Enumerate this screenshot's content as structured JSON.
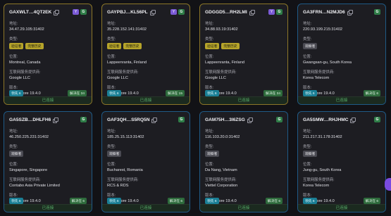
{
  "labels": {
    "address": "地址:",
    "type": "类型:",
    "location": "位置:",
    "isp": "互联网服务提供商:",
    "version": "版本:",
    "status": "已连接"
  },
  "cards": [
    {
      "name": "GAXWLT…4QT2EK",
      "badge1": "Y",
      "badge2": "G",
      "addr": "34.47.29.105:31402",
      "types": [
        "验证者",
        "完整历史"
      ],
      "loc": "Montreal, Canada",
      "isp": "Google LLC",
      "ver": "stellar-core 19.4.0",
      "pill1": "领先 6",
      "pill2": "解决在 34",
      "border": "gold"
    },
    {
      "name": "GAYPBJ…KL56PL",
      "badge1": "Y",
      "badge2": "G",
      "addr": "35.228.152.141:31402",
      "types": [
        "验证者",
        "完整历史"
      ],
      "loc": "Lappeenranta, Finland",
      "isp": "Google LLC",
      "ver": "stellar-core 19.4.0",
      "pill1": "领先 6",
      "pill2": "解决在 15",
      "border": "gold"
    },
    {
      "name": "GDGGD5…RH2LMI",
      "badge1": "Y",
      "badge2": "G",
      "addr": "34.88.93.19:31402",
      "types": [
        "验证者",
        "完整历史"
      ],
      "loc": "Lappeenranta, Finland",
      "isp": "Google LLC",
      "ver": "stellar-core 19.4.0",
      "pill1": "领先 6",
      "pill2": "解决在 34",
      "border": "gold"
    },
    {
      "name": "GA3FRN…N2MJD6",
      "badge1": "",
      "badge2": "G",
      "addr": "220.93.199.215:31402",
      "types": [
        "观察者"
      ],
      "loc": "Gwangsan-gu, South Korea",
      "isp": "Korea Telecom",
      "ver": "stellar-core 19.4.0",
      "pill1": "领先 6",
      "pill2": "解决在 6",
      "border": "blue"
    },
    {
      "name": "GA5SZB…DHLFH6",
      "badge1": "",
      "badge2": "G",
      "addr": "46.250.225.231:31402",
      "types": [
        "观察者"
      ],
      "loc": "Singapore, Singapore",
      "isp": "Contabo Asia Private Limited",
      "ver": "stellar-core 19.4.0",
      "pill1": "领先 6",
      "pill2": "解决在 6",
      "border": "blue"
    },
    {
      "name": "GAF3QH…S5RQ5N",
      "badge1": "",
      "badge2": "G",
      "addr": "185.25.15.113:31402",
      "types": [
        "观察者"
      ],
      "loc": "Bucharest, Romania",
      "isp": "RCS & RDS",
      "ver": "stellar-core 19.4.0",
      "pill1": "领先 6",
      "pill2": "解决在 6",
      "border": "blue"
    },
    {
      "name": "GAM75H…3I6ZSG",
      "badge1": "",
      "badge2": "G",
      "addr": "116.103.20.0:31402",
      "types": [
        "观察者"
      ],
      "loc": "Da Nang, Vietnam",
      "isp": "Viettel Corporation",
      "ver": "stellar-core 19.4.0",
      "pill1": "领先 6",
      "pill2": "解决在 6",
      "border": "blue"
    },
    {
      "name": "GA5SMW…RHJHMC",
      "badge1": "",
      "badge2": "G",
      "addr": "211.217.31.178:31402",
      "types": [
        "观察者"
      ],
      "loc": "Jung-gu, South Korea",
      "isp": "Korea Telecom",
      "ver": "stellar-core 19.4.0",
      "pill1": "领先 6",
      "pill2": "解决在 6",
      "border": "blue"
    }
  ],
  "colors": {
    "accent_gold": "#8d7728",
    "accent_blue": "#1f5a86",
    "status_green": "#59b26b",
    "fab_purple": "#7a4be0"
  }
}
